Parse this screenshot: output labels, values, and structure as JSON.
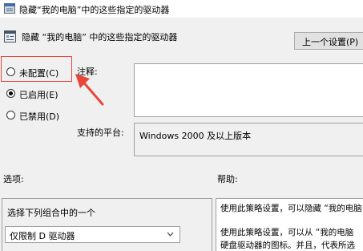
{
  "window": {
    "title": "隐藏“我的电脑”中的这些指定的驱动器"
  },
  "header": {
    "policy_name": "隐藏 “我的电脑” 中的这些指定的驱动器",
    "prev_setting_label": "上一个设置(P)"
  },
  "state_radios": [
    {
      "label": "未配置(C)",
      "checked": false
    },
    {
      "label": "已启用(E)",
      "checked": true
    },
    {
      "label": "已禁用(D)",
      "checked": false
    }
  ],
  "comment": {
    "label": "注释:",
    "value": ""
  },
  "platform": {
    "label": "支持的平台:",
    "value": "Windows 2000 及以上版本"
  },
  "options": {
    "label": "选项:",
    "instruction": "选择下列组合中的一个",
    "selected_value": "仅限制 D 驱动器"
  },
  "help": {
    "label": "帮助:",
    "lines": [
      "使用此策略设置，可以隐藏 “我的电脑",
      "使用此策略设置，可以从 “我的电脑",
      "硬盘驱动器的图标。并且，代表所选"
    ]
  },
  "colors": {
    "annotation": "#e8463b",
    "dialog_bg": "#f0f0f0"
  }
}
